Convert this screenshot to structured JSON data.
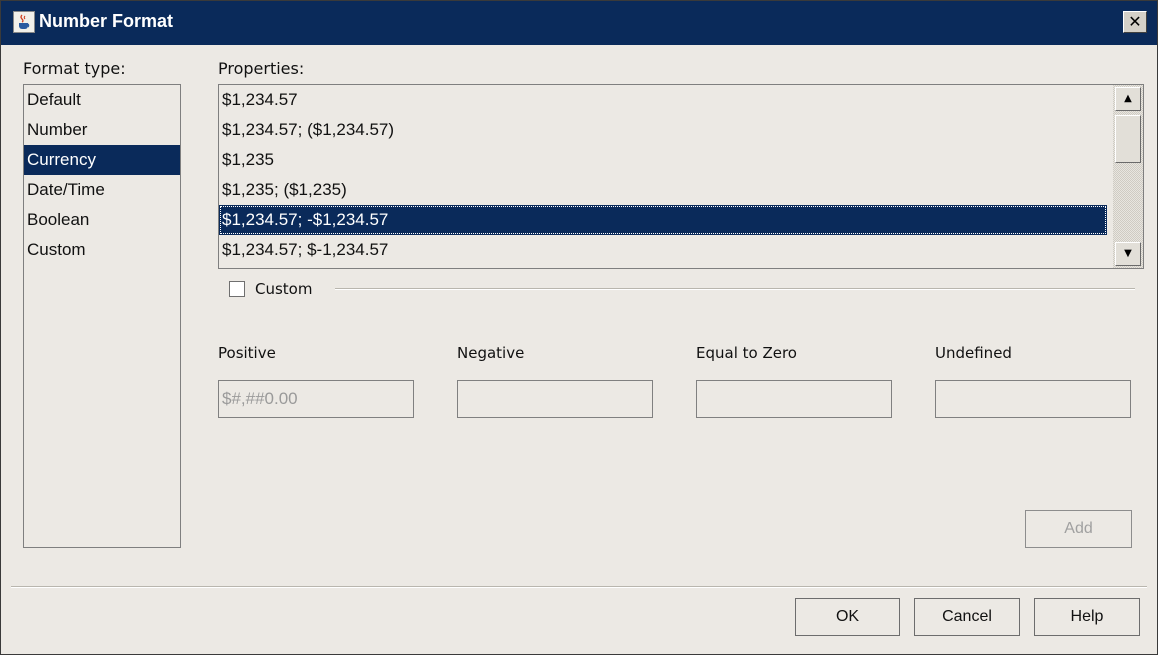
{
  "window": {
    "title": "Number Format",
    "close_glyph": "✕",
    "icon": "java-cup-icon"
  },
  "format_type": {
    "label": "Format type:",
    "items": [
      "Default",
      "Number",
      "Currency",
      "Date/Time",
      "Boolean",
      "Custom"
    ],
    "selected": "Currency"
  },
  "properties": {
    "label": "Properties:",
    "items": [
      "$1,234.57",
      "$1,234.57; ($1,234.57)",
      "$1,235",
      "$1,235; ($1,235)",
      "$1,234.57; -$1,234.57",
      "$1,234.57; $-1,234.57"
    ],
    "selected": "$1,234.57; -$1,234.57"
  },
  "custom": {
    "label": "Custom",
    "checked": false
  },
  "fields": {
    "positive_label": "Positive",
    "positive_value": "$#,##0.00",
    "negative_label": "Negative",
    "negative_value": "",
    "zero_label": "Equal to Zero",
    "zero_value": "",
    "undefined_label": "Undefined",
    "undefined_value": ""
  },
  "buttons": {
    "add": "Add",
    "ok": "OK",
    "cancel": "Cancel",
    "help": "Help"
  },
  "colors": {
    "selection": "#0a2a5a",
    "dialog_bg": "#ece9e4"
  }
}
